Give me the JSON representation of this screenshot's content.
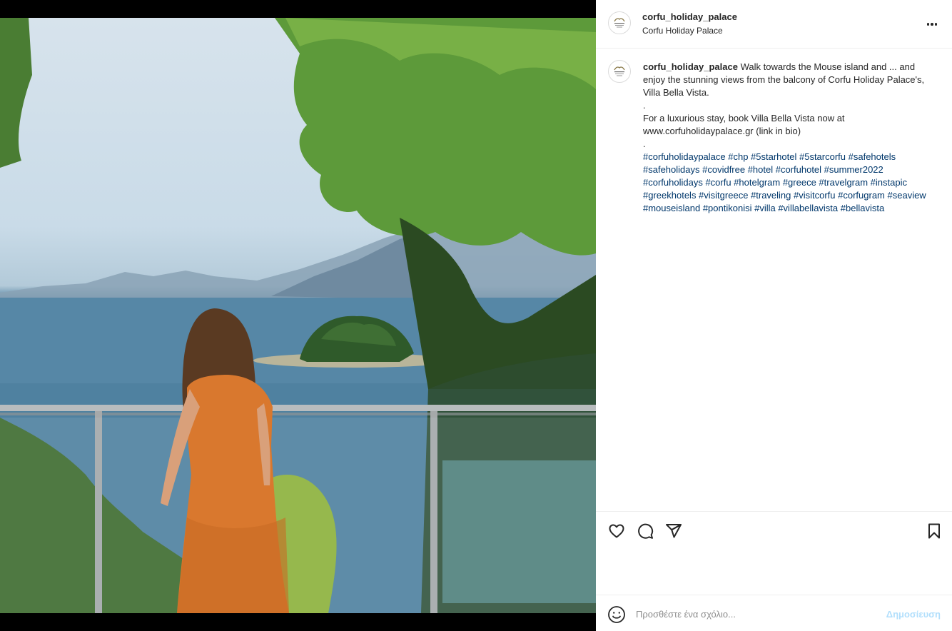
{
  "post": {
    "username": "corfu_holiday_palace",
    "location": "Corfu Holiday Palace",
    "avatar_text": "CORFU HOLIDAY PALACE"
  },
  "caption": {
    "username": "corfu_holiday_palace",
    "line1": "Walk towards the Mouse island and ... and enjoy the stunning views from the balcony of Corfu Holiday Palace's, Villa Bella Vista.",
    "dot1": ".",
    "line2": "For a luxurious stay, book Villa Bella Vista now at www.corfuholidaypalace.gr (link in bio)",
    "dot2": ".",
    "hashtags": "#corfuholidaypalace #chp #5starhotel #5starcorfu #safehotels #safeholidays #covidfree #hotel #corfuhotel #summer2022 #corfuholidays #corfu #hotelgram #greece #travelgram #instapic #greekhotels #visitgreece #traveling #visitcorfu #corfugram #seaview #mouseisland #pontikonisi #villa #villabellavista #bellavista"
  },
  "icons": {
    "like": "heart-icon",
    "comment": "comment-icon",
    "share": "share-icon",
    "save": "bookmark-icon",
    "more": "more-options-icon",
    "emoji": "emoji-icon"
  },
  "comment_box": {
    "placeholder": "Προσθέστε ένα σχόλιο...",
    "post_label": "Δημοσίευση"
  },
  "colors": {
    "link": "#00376b",
    "post_disabled": "#b2dffc",
    "border": "#efefef"
  }
}
